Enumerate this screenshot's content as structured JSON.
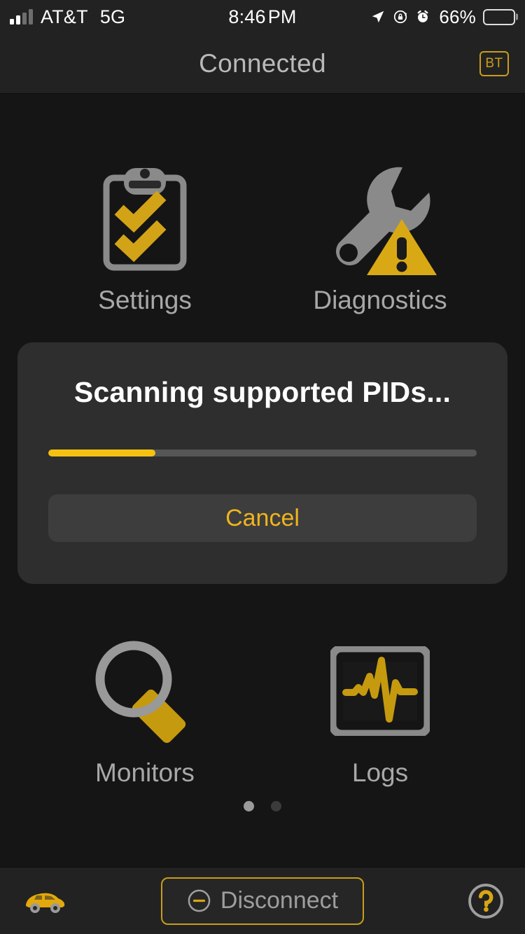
{
  "statusbar": {
    "carrier": "AT&T",
    "network": "5G",
    "time": "8:46",
    "ampm": "PM",
    "battery_percent": "66%",
    "signal_bars_filled": 2,
    "signal_bars_total": 4,
    "icons": [
      "location-arrow-icon",
      "rotation-lock-icon",
      "alarm-clock-icon",
      "battery-icon"
    ]
  },
  "header": {
    "title": "Connected",
    "badge_label": "BT"
  },
  "main": {
    "tiles": [
      {
        "label": "Settings",
        "icon": "clipboard-checklist-icon"
      },
      {
        "label": "Diagnostics",
        "icon": "wrench-warning-icon"
      },
      {
        "label": "Monitors",
        "icon": "magnifier-icon"
      },
      {
        "label": "Logs",
        "icon": "waveform-monitor-icon"
      }
    ],
    "page_dots": {
      "count": 2,
      "active_index": 0
    }
  },
  "dialog": {
    "title": "Scanning supported PIDs...",
    "progress_percent": 25,
    "cancel_label": "Cancel"
  },
  "bottombar": {
    "car_icon": "car-icon",
    "disconnect_label": "Disconnect",
    "disconnect_icon": "minus-circle-icon",
    "help_icon": "question-mark-circle-icon"
  },
  "colors": {
    "accent_gold": "#f5c211",
    "accent_gold_dim": "#c79d1a",
    "icon_gray": "#8a8a8a",
    "bg_main": "#151515",
    "bg_bar": "#222222",
    "dialog_bg": "#2e2e2e"
  }
}
